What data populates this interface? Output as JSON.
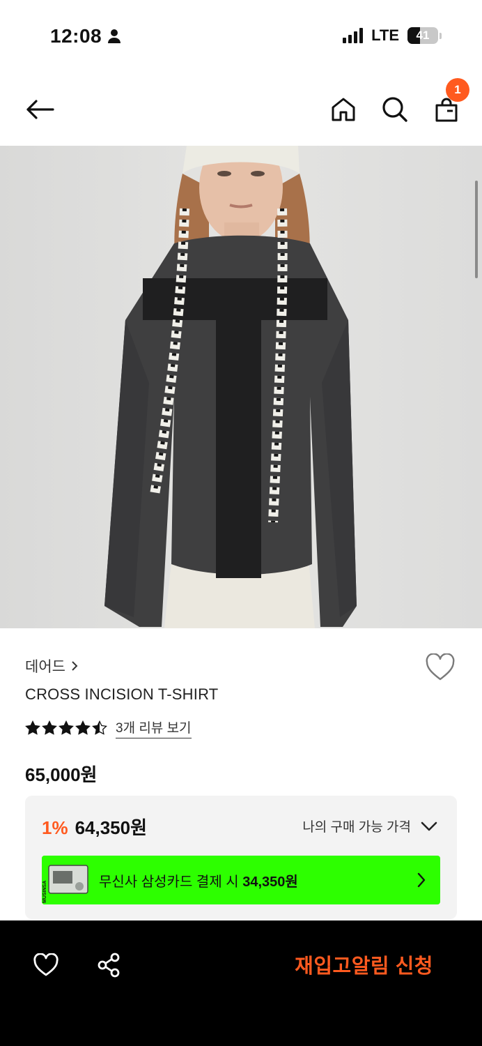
{
  "status": {
    "time": "12:08",
    "network": "LTE",
    "battery": "41",
    "battery_level": 0.41
  },
  "nav": {
    "cart_count": "1"
  },
  "product": {
    "brand": "데어드",
    "name": "CROSS INCISION T-SHIRT",
    "rating": 4.5,
    "review_link": "3개 리뷰 보기",
    "price": "65,000원"
  },
  "price_box": {
    "discount_rate": "1%",
    "discount_price": "64,350원",
    "my_price_label": "나의 구매 가능 가격",
    "card_text": "무신사 삼성카드 결제 시",
    "card_price": "34,350원",
    "card_thumb_text": "MUSINSA"
  },
  "bottom_bar": {
    "restock_label": "재입고알림 신청"
  },
  "colors": {
    "accent": "#ff5a1f",
    "card_banner": "#2dff00",
    "bottom_bar": "#000000"
  }
}
